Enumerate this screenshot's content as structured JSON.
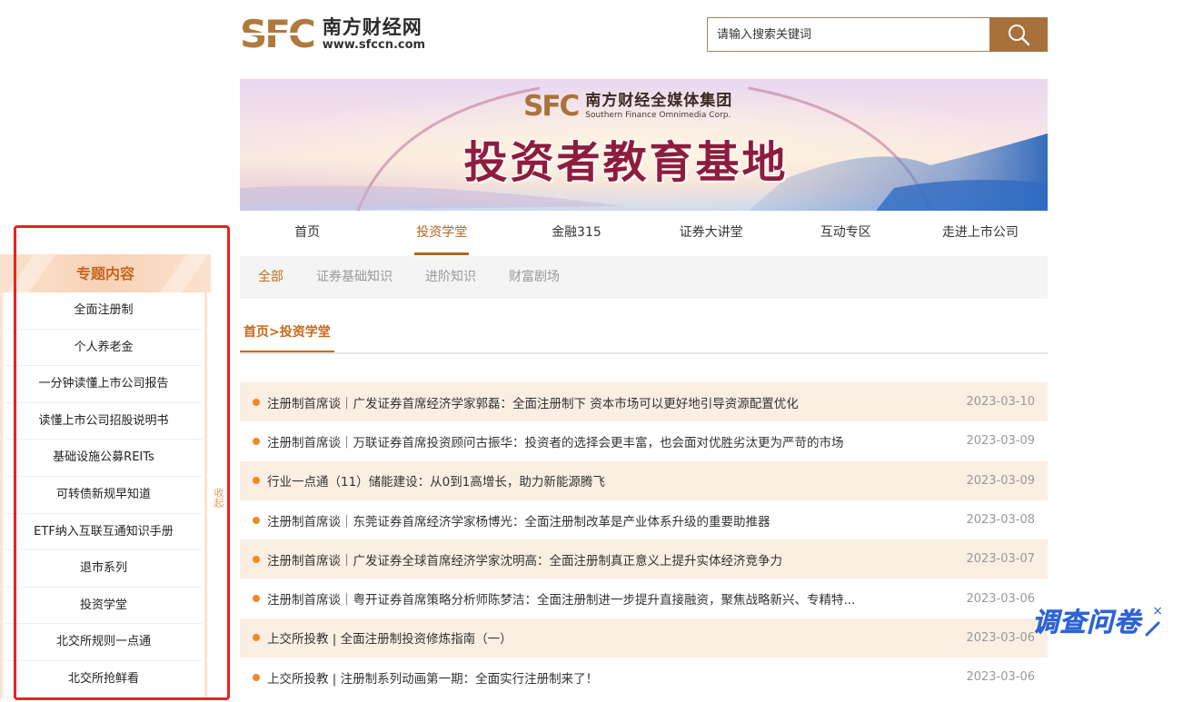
{
  "logo": {
    "mark": "SFC",
    "name": "南方财经网",
    "url": "www.sfccn.com"
  },
  "search": {
    "placeholder": "请输入搜索关键词"
  },
  "banner": {
    "group_mark": "SFC",
    "group_name": "南方财经全媒体集团",
    "group_en": "Southern Finance Omnimedia Corp.",
    "title": "投资者教育基地"
  },
  "nav": {
    "items": [
      "首页",
      "投资学堂",
      "金融315",
      "证券大讲堂",
      "互动专区",
      "走进上市公司"
    ],
    "active_index": 1
  },
  "subnav": {
    "items": [
      "全部",
      "证券基础知识",
      "进阶知识",
      "财富剧场"
    ],
    "active_index": 0
  },
  "breadcrumb": {
    "home": "首页",
    "separator": ">",
    "current": "投资学堂"
  },
  "articles": [
    {
      "title": "注册制首席谈｜广发证券首席经济学家郭磊：全面注册制下 资本市场可以更好地引导资源配置优化",
      "date": "2023-03-10"
    },
    {
      "title": "注册制首席谈｜万联证券首席投资顾问古振华：投资者的选择会更丰富，也会面对优胜劣汰更为严苛的市场",
      "date": "2023-03-09"
    },
    {
      "title": "行业一点通（11）储能建设：从0到1高增长，助力新能源腾飞",
      "date": "2023-03-09"
    },
    {
      "title": "注册制首席谈｜东莞证券首席经济学家杨博光：全面注册制改革是产业体系升级的重要助推器",
      "date": "2023-03-08"
    },
    {
      "title": "注册制首席谈｜广发证券全球首席经济学家沈明高：全面注册制真正意义上提升实体经济竞争力",
      "date": "2023-03-07"
    },
    {
      "title": "注册制首席谈｜粤开证券首席策略分析师陈梦洁：全面注册制进一步提升直接融资，聚焦战略新兴、专精特...",
      "date": "2023-03-06"
    },
    {
      "title": "上交所投教 | 全面注册制投资修炼指南（一）",
      "date": "2023-03-06"
    },
    {
      "title": "上交所投教 | 注册制系列动画第一期：全面实行注册制来了！",
      "date": "2023-03-06"
    }
  ],
  "sidebar": {
    "title": "专题内容",
    "items": [
      "全面注册制",
      "个人养老金",
      "一分钟读懂上市公司报告",
      "读懂上市公司招股说明书",
      "基础设施公募REITs",
      "可转债新规早知道",
      "ETF纳入互联互通知识手册",
      "退市系列",
      "投资学堂",
      "北交所规则一点通",
      "北交所抢鲜看"
    ],
    "collapse_label": "收起"
  },
  "survey": {
    "label": "调查问卷",
    "close": "×"
  },
  "colors": {
    "brand_gold": "#b07a3c",
    "accent_orange": "#c76a1a",
    "dot_orange": "#f08a24",
    "row_tint": "#fbeee3",
    "highlight_red": "#e8231f",
    "survey_blue": "#2d63d8"
  }
}
